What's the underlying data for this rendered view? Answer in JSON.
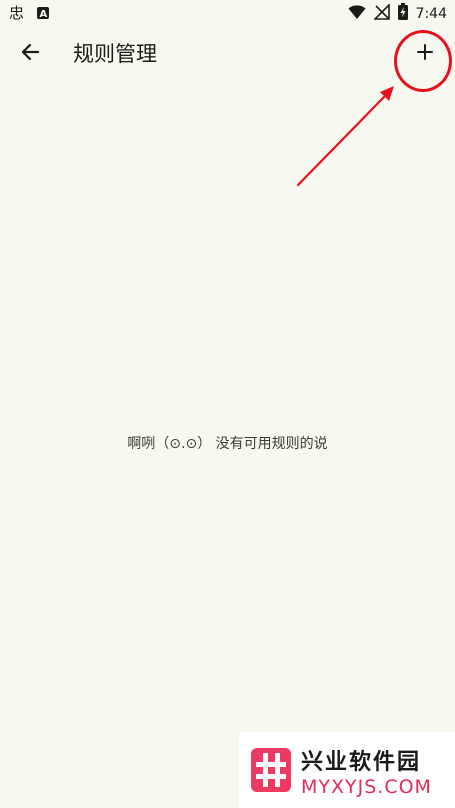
{
  "status_bar": {
    "time": "7:44",
    "left_icons": [
      "chinese-ime-icon",
      "notification-a-icon"
    ],
    "right_icons": [
      "wifi-icon",
      "no-signal-icon",
      "battery-charging-icon"
    ]
  },
  "app_bar": {
    "title": "规则管理",
    "back_icon": "arrow-left-icon",
    "add_icon": "plus-icon"
  },
  "empty_state": {
    "message": "啊咧（⊙.⊙） 没有可用规则的说"
  },
  "watermark": {
    "title": "兴业软件园",
    "subtitle": "MYXYJS.COM"
  },
  "annotation": {
    "color": "#e8111b"
  },
  "colors": {
    "background": "#f7f9f0",
    "text": "#1b1c18",
    "annotation": "#e8111b",
    "watermark_accent": "#e42b57"
  }
}
